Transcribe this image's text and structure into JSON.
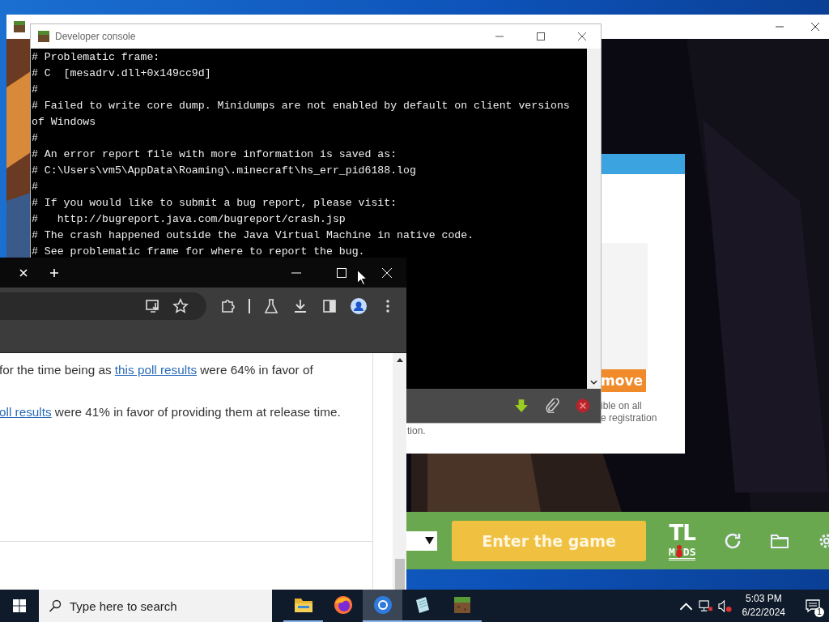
{
  "launcher_window": {
    "dialog": {
      "button_label": "move",
      "text_lines": [
        "ible on all",
        "e registration"
      ],
      "footer_text": "tion."
    },
    "bottom_bar": {
      "play_button": "Enter the game",
      "logo": {
        "top": "TL",
        "left": "M",
        "right": "DS"
      }
    }
  },
  "console_window": {
    "title": "Developer console",
    "lines": [
      "# Problematic frame:",
      "# C  [mesadrv.dll+0x149cc9d]",
      "#",
      "# Failed to write core dump. Minidumps are not enabled by default on client versions",
      "of Windows",
      "#",
      "# An error report file with more information is saved as:",
      "# C:\\Users\\vm5\\AppData\\Roaming\\.minecraft\\hs_err_pid6188.log",
      "#",
      "# If you would like to submit a bug report, please visit:",
      "#   http://bugreport.java.com/bugreport/crash.jsp",
      "# The crash happened outside the Java Virtual Machine in native code.",
      "# See problematic frame for where to report the bug."
    ]
  },
  "browser_window": {
    "paragraphs": [
      {
        "before": "for the time being as ",
        "link": "this poll results",
        "after": " were 64% in favor of"
      },
      {
        "link": "oll results",
        "after": " were 41% in favor of providing them at release time."
      }
    ]
  },
  "taskbar": {
    "search_placeholder": "Type here to search",
    "apps": [
      {
        "kind": "explorer",
        "running": true,
        "selected": false
      },
      {
        "kind": "firefox",
        "running": false,
        "selected": false
      },
      {
        "kind": "chrome",
        "running": true,
        "selected": true
      },
      {
        "kind": "notepad",
        "running": true,
        "selected": false
      },
      {
        "kind": "minecraft",
        "running": true,
        "selected": false
      }
    ],
    "time": "5:03 PM",
    "date": "6/22/2024",
    "notification_count": "1"
  }
}
